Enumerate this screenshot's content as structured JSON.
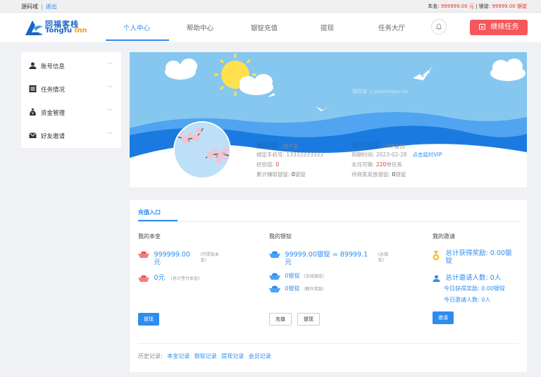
{
  "topbar": {
    "site_name": "源码域",
    "separator": "|",
    "logout": "退出",
    "balance_label": "本金:",
    "balance_value": "999999.00 元",
    "sep": "|",
    "ingot_label": "银锭:",
    "ingot_value": "99999.00 银锭"
  },
  "logo": {
    "cn": "同福客栈",
    "en_part1": "Tongfu ",
    "en_part2": "Inn"
  },
  "nav": {
    "items": [
      "个人中心",
      "帮助中心",
      "银锭充值",
      "提现",
      "任务大厅"
    ],
    "active_index": 0,
    "continue_task": "继续任务"
  },
  "sidebar": {
    "items": [
      {
        "label": "账号信息",
        "icon": "user-icon"
      },
      {
        "label": "任务情况",
        "icon": "list-icon"
      },
      {
        "label": "资金管理",
        "icon": "money-bag-icon"
      },
      {
        "label": "好友邀请",
        "icon": "envelope-icon"
      }
    ]
  },
  "profile": {
    "watermark": "源码域 ·s.yuanmayu.cn",
    "username": "源码域",
    "username_sub": "/用户名",
    "phone_label": "绑定手机号: ",
    "phone": "13333333333",
    "exp_label": "经验值: ",
    "exp": "0",
    "earned_label": "累计赚取银锭: ",
    "earned": "0",
    "earned_unit": "银锭",
    "vip_title": "会员状态",
    "vip_sub": "/ VIP会员",
    "expire_label": "到期时间: ",
    "expire": "2023-02-28",
    "renew_link": "点击延时VIP",
    "month_label": "本月可做: ",
    "month_count": "220",
    "month_unit": "单任务",
    "pending_label": "待商家发放银锭: ",
    "pending": "0",
    "pending_unit": "银锭"
  },
  "recharge": {
    "tab": "充值入口",
    "principal": {
      "title": "我的本金",
      "amount_line1": "999999.00",
      "amount_line2": "元",
      "amount_note": "(可提现本金)",
      "pay_amount": "0元",
      "pay_note": "(总计垫付本金)",
      "withdraw_btn": "提现"
    },
    "ingot": {
      "title": "我的银锭",
      "total_line1": "99999.00银锭 = 89999.1",
      "total_line2": "元",
      "total_note": "(总银锭)",
      "frozen": "0银锭",
      "frozen_note": "(冻结银锭)",
      "extra": "0银锭",
      "extra_note": "(额外奖励)",
      "recharge_btn": "充值",
      "withdraw_btn": "提现"
    },
    "invite": {
      "title": "我的邀请",
      "reward_line1": "总计获得奖励: 0.00银",
      "reward_line2": "锭",
      "count": "总计邀请人数: 0人",
      "today_reward": "今日获得奖励: 0.00银锭",
      "today_count": "今日邀请人数: 0人",
      "invite_btn": "邀请"
    },
    "history": {
      "label": "历史记录:",
      "links": [
        "本金记录",
        "银锭记录",
        "提现记录",
        "会员记录"
      ]
    }
  },
  "colors": {
    "primary": "#2d8cf0",
    "danger": "#f5575c",
    "brand": "#1a67c2",
    "sky": "#86c7f0"
  }
}
